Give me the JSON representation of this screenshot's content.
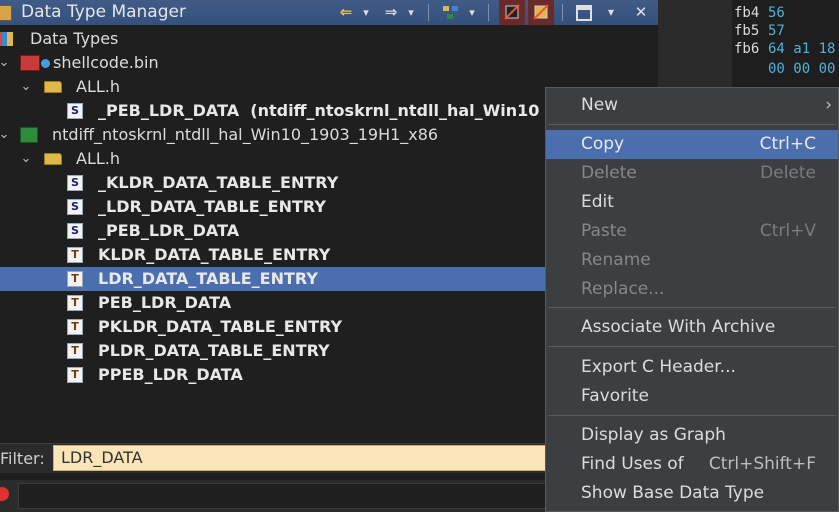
{
  "window": {
    "title": "Data Type Manager",
    "toolbar": {
      "back": "⇐",
      "forward": "⇒",
      "dropdown": "▾",
      "close": "✕"
    }
  },
  "tree": {
    "root_label": "Data Types",
    "archive1": {
      "label": "shellcode.bin",
      "folder": "ALL.h",
      "item": "_PEB_LDR_DATA",
      "item_suffix": "(ntdiff_ntoskrnl_ntdll_hal_Win10"
    },
    "archive2": {
      "label": "ntdiff_ntoskrnl_ntdll_hal_Win10_1903_19H1_x86",
      "folder": "ALL.h",
      "items": [
        "_KLDR_DATA_TABLE_ENTRY",
        "_LDR_DATA_TABLE_ENTRY",
        "_PEB_LDR_DATA",
        "KLDR_DATA_TABLE_ENTRY",
        "LDR_DATA_TABLE_ENTRY",
        "PEB_LDR_DATA",
        "PKLDR_DATA_TABLE_ENTRY",
        "PLDR_DATA_TABLE_ENTRY",
        "PPEB_LDR_DATA"
      ]
    }
  },
  "filter": {
    "label": "Filter:",
    "value": "LDR_DATA"
  },
  "listing": {
    "lines": [
      {
        "addr": "fb4",
        "hex": "56"
      },
      {
        "addr": "fb5",
        "hex": "57"
      },
      {
        "addr": "fb6",
        "hex": "64 a1 18"
      },
      {
        "addr": "",
        "hex": "00 00 00"
      }
    ]
  },
  "context_menu": {
    "items": [
      {
        "label": "New",
        "shortcut": "",
        "submenu": "›"
      },
      {
        "label": "Copy",
        "shortcut": "Ctrl+C"
      },
      {
        "label": "Delete",
        "shortcut": "Delete"
      },
      {
        "label": "Edit",
        "shortcut": ""
      },
      {
        "label": "Paste",
        "shortcut": "Ctrl+V"
      },
      {
        "label": "Rename",
        "shortcut": ""
      },
      {
        "label": "Replace...",
        "shortcut": ""
      },
      {
        "label": "Associate With Archive",
        "shortcut": ""
      },
      {
        "label": "Export C Header...",
        "shortcut": ""
      },
      {
        "label": "Favorite",
        "shortcut": ""
      },
      {
        "label": "Display as Graph",
        "shortcut": ""
      },
      {
        "label": "Find Uses of",
        "shortcut": "Ctrl+Shift+F"
      },
      {
        "label": "Show Base Data Type",
        "shortcut": ""
      }
    ]
  }
}
